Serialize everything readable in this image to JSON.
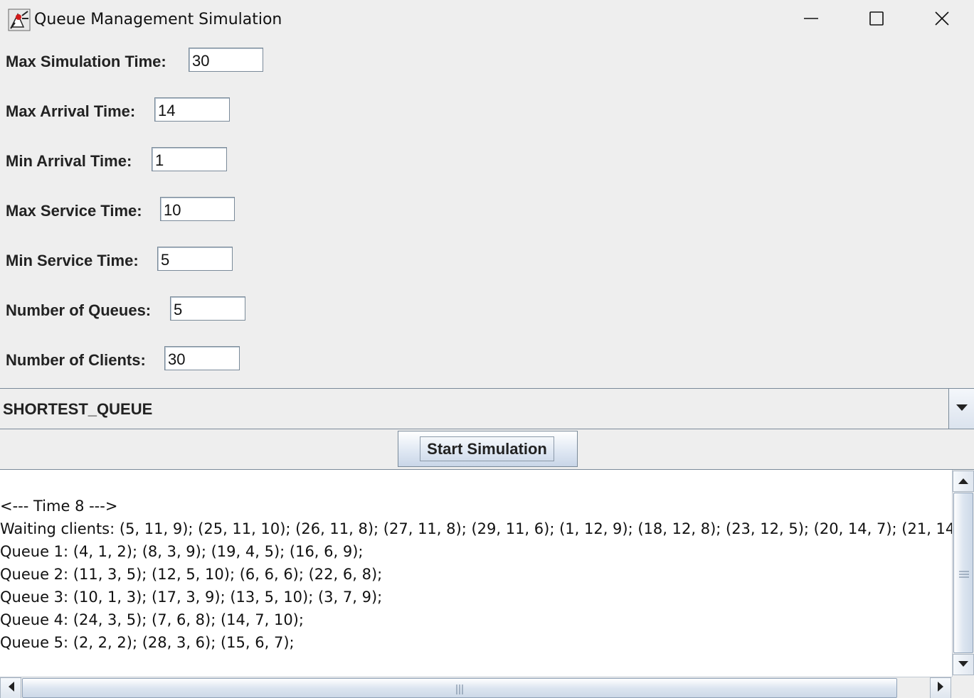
{
  "window": {
    "title": "Queue Management Simulation"
  },
  "form": {
    "fields": [
      {
        "label": "Max Simulation Time:",
        "value": "30"
      },
      {
        "label": "Max Arrival Time:",
        "value": "14"
      },
      {
        "label": "Min Arrival Time:",
        "value": "1"
      },
      {
        "label": "Max Service Time:",
        "value": "10"
      },
      {
        "label": "Min Service Time:",
        "value": "5"
      },
      {
        "label": "Number of Queues:",
        "value": "5"
      },
      {
        "label": "Number of Clients:",
        "value": "30"
      }
    ],
    "strategy": "SHORTEST_QUEUE",
    "start_label": "Start Simulation"
  },
  "output": {
    "lines": [
      "",
      "<--- Time 8 --->",
      "Waiting clients: (5, 11, 9); (25, 11, 10); (26, 11, 8); (27, 11, 8); (29, 11, 6); (1, 12, 9); (18, 12, 8); (23, 12, 5); (20, 14, 7); (21, 14",
      "Queue 1: (4, 1, 2); (8, 3, 9); (19, 4, 5); (16, 6, 9);",
      "Queue 2: (11, 3, 5); (12, 5, 10); (6, 6, 6); (22, 6, 8);",
      "Queue 3: (10, 1, 3); (17, 3, 9); (13, 5, 10); (3, 7, 9);",
      "Queue 4: (24, 3, 5); (7, 6, 8); (14, 7, 10);",
      "Queue 5: (2, 2, 2); (28, 3, 6); (15, 6, 7);"
    ]
  },
  "icons": {
    "app": "java-duke-icon",
    "minimize": "minimize-icon",
    "maximize": "maximize-icon",
    "close": "close-icon"
  }
}
